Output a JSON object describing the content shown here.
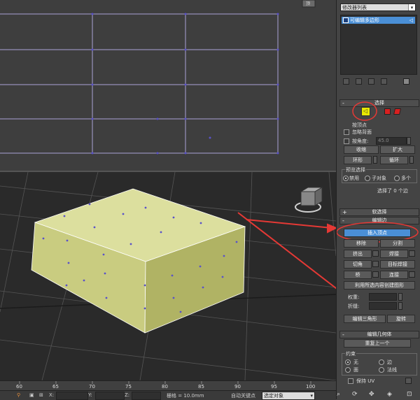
{
  "timeline": {
    "ticks": [
      "60",
      "65",
      "70",
      "75",
      "80",
      "85",
      "90",
      "95",
      "100"
    ]
  },
  "statusbar": {
    "x_label": "X:",
    "y_label": "Y:",
    "z_label": "Z:",
    "grid_text": "栅格 = 10.0mm",
    "autokey": "自动关键点",
    "sel_objects": "选定对象"
  },
  "viewport_top": {
    "gizmo_label": "顶"
  },
  "command_panel": {
    "modifier_list": "修改器列表",
    "stack_item": "可编辑多边形",
    "selection": {
      "title": "选择",
      "by_vertex": "按顶点",
      "ignore_backfacing": "忽略背面",
      "by_angle": "按角度:",
      "angle_value": "45.0",
      "shrink": "收缩",
      "grow": "扩大",
      "ring": "环形",
      "loop": "循环",
      "preview_title": "预览选择",
      "preview_opts": [
        "禁用",
        "子对象",
        "多个"
      ],
      "status": "选择了 0 个边"
    },
    "soft_selection": {
      "title": "软选择"
    },
    "edit_edges": {
      "title": "编辑边",
      "insert_vertex": "插入顶点",
      "remove": "移除",
      "split": "分割",
      "extrude": "挤出",
      "weld": "焊接",
      "chamfer": "切角",
      "target_weld": "目标焊接",
      "bridge": "桥",
      "connect": "连接",
      "create_shape": "利用所选内容创建图形",
      "weight": "权重:",
      "crease": "折缝:",
      "edit_tri": "编辑三角形",
      "turn": "旋转"
    },
    "edit_geometry": {
      "title": "编辑几何体",
      "repeat_last": "重复上一个",
      "constraints_title": "约束",
      "c_none": "无",
      "c_edge": "边",
      "c_face": "面",
      "c_normal": "法线",
      "preserve_uv": "保持 UV"
    }
  },
  "colors": {
    "accent_red": "#e53935",
    "selected_blue": "#4a8fd6",
    "box_face": "#d6d99a"
  }
}
